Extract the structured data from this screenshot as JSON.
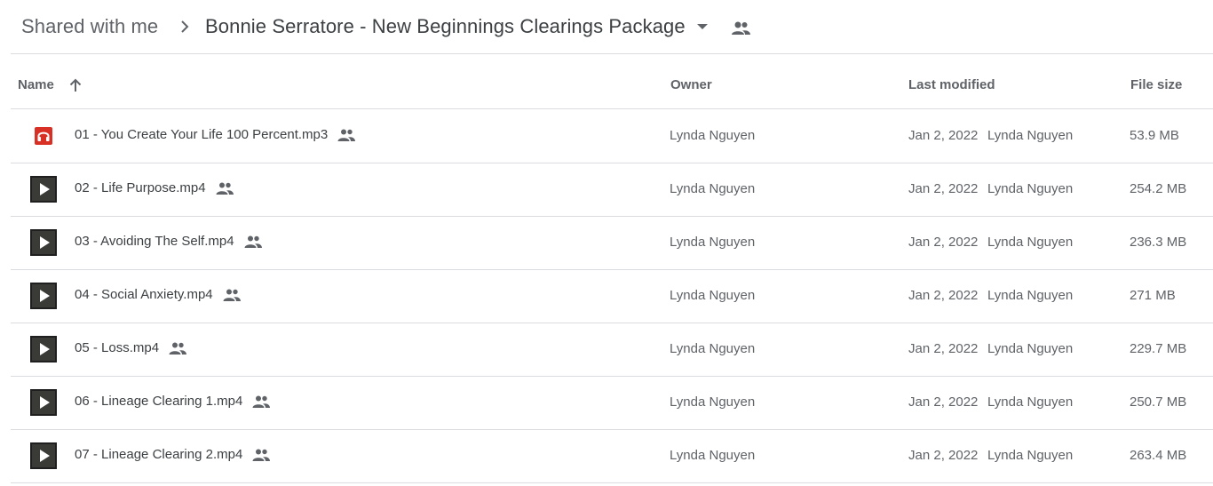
{
  "breadcrumb": {
    "root": "Shared with me",
    "current": "Bonnie Serratore - New Beginnings Clearings Package"
  },
  "columns": {
    "name": "Name",
    "owner": "Owner",
    "last_modified": "Last modified",
    "file_size": "File size"
  },
  "files": [
    {
      "name": "01 - You Create Your Life 100 Percent.mp3",
      "type": "audio",
      "icon": "headphones-icon",
      "owner": "Lynda Nguyen",
      "modified_date": "Jan 2, 2022",
      "modified_by": "Lynda Nguyen",
      "size": "53.9 MB"
    },
    {
      "name": "02 - Life Purpose.mp4",
      "type": "video",
      "icon": "video-play-icon",
      "owner": "Lynda Nguyen",
      "modified_date": "Jan 2, 2022",
      "modified_by": "Lynda Nguyen",
      "size": "254.2 MB"
    },
    {
      "name": "03 - Avoiding The Self.mp4",
      "type": "video",
      "icon": "video-play-icon",
      "owner": "Lynda Nguyen",
      "modified_date": "Jan 2, 2022",
      "modified_by": "Lynda Nguyen",
      "size": "236.3 MB"
    },
    {
      "name": "04 - Social Anxiety.mp4",
      "type": "video",
      "icon": "video-play-icon",
      "owner": "Lynda Nguyen",
      "modified_date": "Jan 2, 2022",
      "modified_by": "Lynda Nguyen",
      "size": "271 MB"
    },
    {
      "name": "05 - Loss.mp4",
      "type": "video",
      "icon": "video-play-icon",
      "owner": "Lynda Nguyen",
      "modified_date": "Jan 2, 2022",
      "modified_by": "Lynda Nguyen",
      "size": "229.7 MB"
    },
    {
      "name": "06 - Lineage Clearing 1.mp4",
      "type": "video",
      "icon": "video-play-icon",
      "owner": "Lynda Nguyen",
      "modified_date": "Jan 2, 2022",
      "modified_by": "Lynda Nguyen",
      "size": "250.7 MB"
    },
    {
      "name": "07 - Lineage Clearing 2.mp4",
      "type": "video",
      "icon": "video-play-icon",
      "owner": "Lynda Nguyen",
      "modified_date": "Jan 2, 2022",
      "modified_by": "Lynda Nguyen",
      "size": "263.4 MB"
    }
  ],
  "colors": {
    "audio_icon": "#d93025",
    "video_thumb": "#1f1f1f",
    "text_primary": "#3c4043",
    "text_secondary": "#5f6368",
    "divider": "#dadce0"
  }
}
